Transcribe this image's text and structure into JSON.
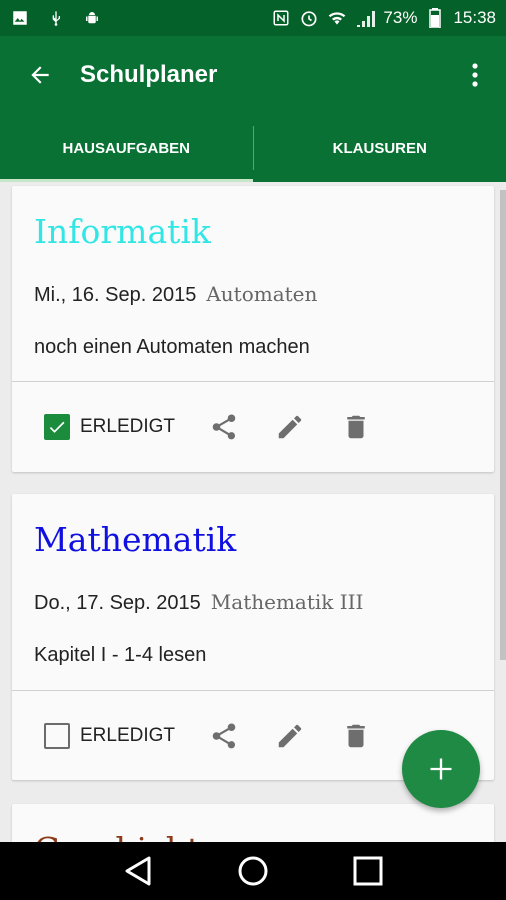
{
  "statusbar": {
    "battery_percent": "73%",
    "time": "15:38",
    "icons": [
      "image-icon",
      "usb-icon",
      "android-debug-icon",
      "nfc-icon",
      "alarm-icon",
      "wifi-icon",
      "cell-signal-icon",
      "battery-icon"
    ]
  },
  "appbar": {
    "title": "Schulplaner",
    "back_icon": "arrow-back-icon",
    "menu_icon": "more-vert-icon"
  },
  "tabs": [
    {
      "label": "HAUSAUFGABEN",
      "active": true
    },
    {
      "label": "KLAUSUREN",
      "active": false
    }
  ],
  "cards": [
    {
      "subject": "Informatik",
      "subject_color": "#33e6e6",
      "date": "Mi., 16. Sep. 2015",
      "topic": "Automaten",
      "description": "noch einen Automaten machen",
      "done_label": "ERLEDIGT",
      "done": true
    },
    {
      "subject": "Mathematik",
      "subject_color": "#1010e0",
      "date": "Do., 17. Sep. 2015",
      "topic": "Mathematik III",
      "description": "Kapitel I - 1-4 lesen",
      "done_label": "ERLEDIGT",
      "done": false
    },
    {
      "subject": "Geschichte",
      "subject_color": "#8b3a1a"
    }
  ],
  "colors": {
    "status_bar": "#05612a",
    "app_bar": "#087133",
    "fab": "#1e8a44",
    "check": "#1b8b3c"
  }
}
